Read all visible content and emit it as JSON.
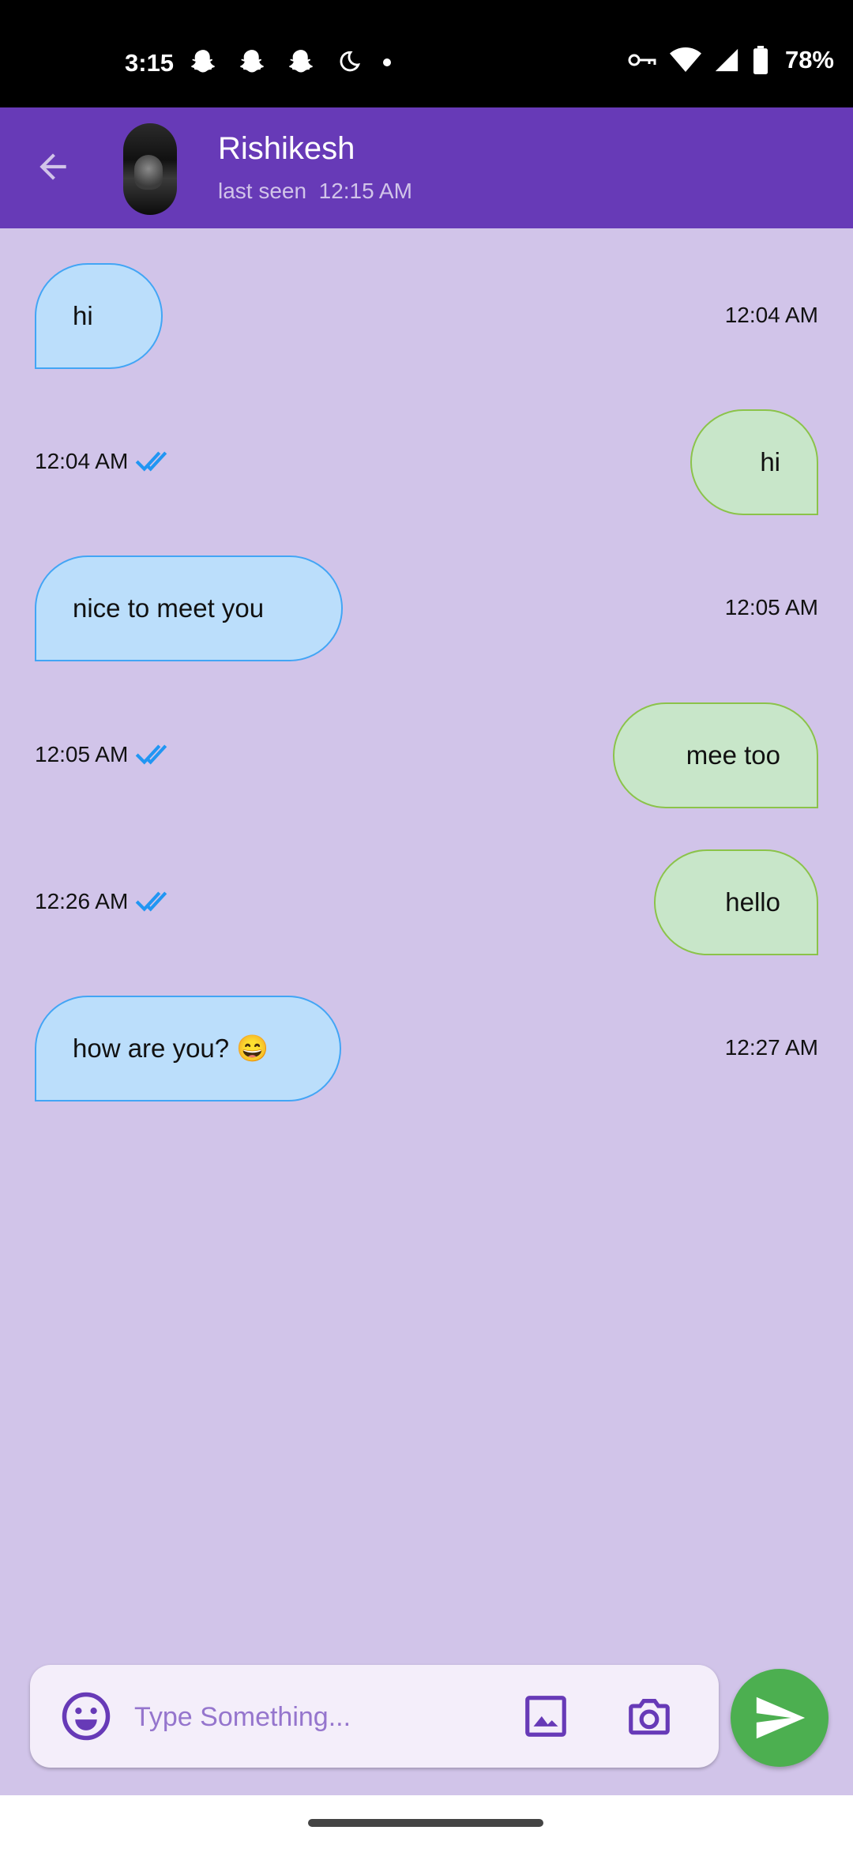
{
  "status_bar": {
    "time": "3:15",
    "battery": "78%",
    "icons": [
      "snapchat-icon",
      "snapchat-icon",
      "snapchat-icon",
      "moon-icon",
      "dot-icon",
      "key-icon",
      "wifi-icon",
      "signal-icon",
      "battery-icon"
    ]
  },
  "header": {
    "name": "Rishikesh",
    "last_seen": "last seen  12:15 AM",
    "icons": [
      "back-arrow-icon",
      "avatar"
    ]
  },
  "messages": [
    {
      "direction": "incoming",
      "text": "hi",
      "time": "12:04 AM"
    },
    {
      "direction": "outgoing",
      "text": "hi",
      "time": "12:04 AM",
      "read": true
    },
    {
      "direction": "incoming",
      "text": "nice to meet you",
      "time": "12:05 AM"
    },
    {
      "direction": "outgoing",
      "text": "mee too",
      "time": "12:05 AM",
      "read": true
    },
    {
      "direction": "outgoing",
      "text": "hello",
      "time": "12:26 AM",
      "read": true
    },
    {
      "direction": "incoming",
      "text": "how are you? 😄",
      "time": "12:27 AM"
    }
  ],
  "composer": {
    "placeholder": "Type Something...",
    "icons": [
      "emoji-icon",
      "gallery-icon",
      "camera-icon",
      "send-icon"
    ]
  },
  "colors": {
    "app_bar": "#673AB7",
    "background": "#D1C4E9",
    "incoming_bubble": "#BBDEFB",
    "incoming_border": "#42A5F5",
    "outgoing_bubble": "#C8E6C9",
    "outgoing_border": "#8BC34A",
    "read_ticks": "#2196F3",
    "send_button": "#4CAF50"
  }
}
